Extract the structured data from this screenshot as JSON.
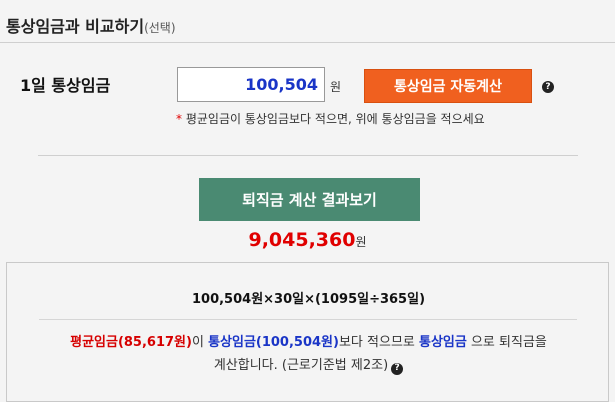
{
  "header": {
    "title": "통상임금과 비교하기",
    "optional": "(선택)"
  },
  "wage_row": {
    "label": "1일 통상임금",
    "value": "100,504",
    "unit": "원",
    "auto_button": "통상임금 자동계산",
    "help_glyph": "?"
  },
  "hint": {
    "star": "*",
    "text": "평균임금이 통상임금보다 적으면, 위에 통상임금을 적으세요"
  },
  "calc_button": "퇴직금 계산 결과보기",
  "result": {
    "amount": "9,045,360",
    "unit": "원"
  },
  "panel": {
    "formula": "100,504원×30일×(1095일÷365일)",
    "avg_wage": "평균임금(85,617원)",
    "text_1": "이 ",
    "ordinary_wage": "통상임금(100,504원)",
    "text_2": "보다 적으므로 ",
    "ordinary_label": "통상임금",
    "text_3": " 으로 퇴직금을",
    "text_4": "계산합니다. (근로기준법 제2조)",
    "help_glyph": "?"
  },
  "colors": {
    "orange_button": "#f0601f",
    "green_button": "#4a8a72",
    "red_text": "#e00000",
    "blue_text": "#1a35c7"
  }
}
